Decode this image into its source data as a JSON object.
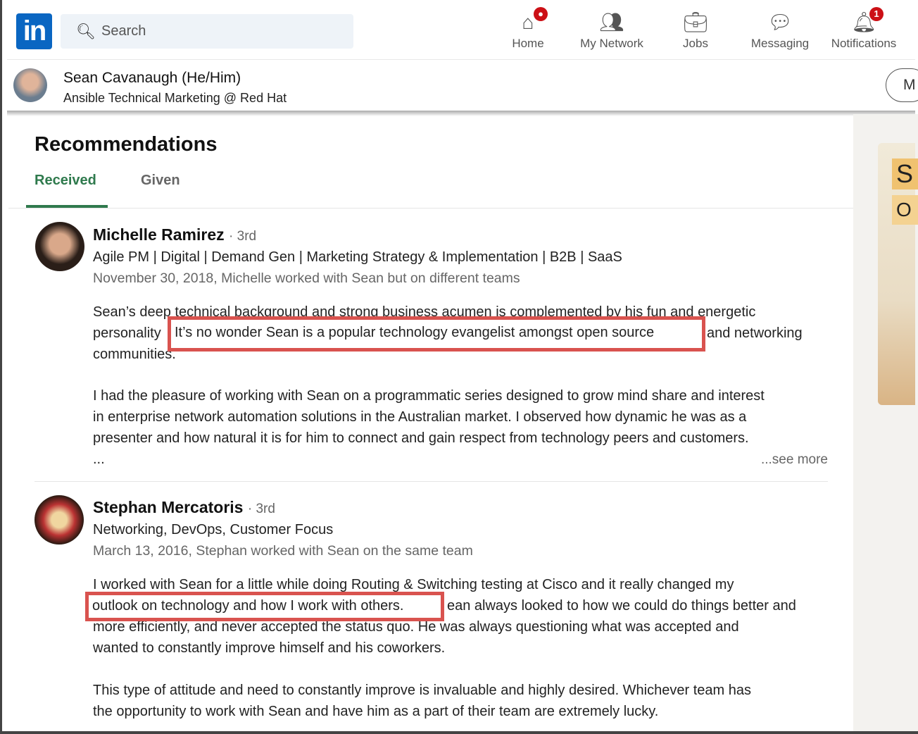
{
  "header": {
    "logo": "in",
    "search_placeholder": "Search",
    "nav": [
      {
        "label": "Home",
        "icon": "home-icon",
        "badge": "●"
      },
      {
        "label": "My Network",
        "icon": "people-icon"
      },
      {
        "label": "Jobs",
        "icon": "briefcase-icon"
      },
      {
        "label": "Messaging",
        "icon": "chat-icon"
      },
      {
        "label": "Notifications",
        "icon": "bell-icon",
        "badge": "1"
      }
    ]
  },
  "profile": {
    "name": "Sean Cavanaugh",
    "pronouns": "(He/Him)",
    "headline": "Ansible Technical Marketing @ Red Hat",
    "button": "M"
  },
  "ad": {
    "l1": "S",
    "l2": "O"
  },
  "section": {
    "title": "Recommendations",
    "tabs": [
      "Received",
      "Given"
    ],
    "active_tab": "Received",
    "accent": "#2f7a4d",
    "highlight": "#d9534f"
  },
  "recommendations": [
    {
      "name": "Michelle Ramirez",
      "degree": "· 3rd",
      "headline": "Agile PM | Digital | Demand Gen | Marketing Strategy & Implementation | B2B | SaaS",
      "date": "November 30, 2018, Michelle worked with Sean but on different teams",
      "lines": [
        "Sean’s deep technical background and strong business acumen is complemented by his fun and energetic",
        "personality",
        "and networking",
        "communities.",
        "I had the pleasure of working with Sean on a programmatic series designed to grow mind share and interest",
        "in enterprise network automation solutions in the Australian market. I observed how dynamic he was as a",
        "presenter and how natural it is for him to connect and gain respect from technology peers and customers.",
        "..."
      ],
      "highlight": "It’s no wonder Sean is a popular technology evangelist amongst open source",
      "see_more": "...see more"
    },
    {
      "name": "Stephan Mercatoris",
      "degree": "· 3rd",
      "headline": "Networking, DevOps, Customer Focus",
      "date": "March 13, 2016, Stephan worked with Sean on the same team",
      "lines": [
        "I worked with Sean for a little while doing Routing & Switching testing at Cisco and it really changed my",
        "ean always looked to how we could do things better and",
        "more efficiently, and never accepted the status quo. He was always questioning what was accepted and",
        "wanted to constantly improve himself and his coworkers.",
        "This type of attitude and need to constantly improve is invaluable and highly desired. Whichever team has",
        "the opportunity to work with Sean and have him as a part of their team are extremely lucky."
      ],
      "highlight": "outlook on technology and how I work with others."
    }
  ]
}
